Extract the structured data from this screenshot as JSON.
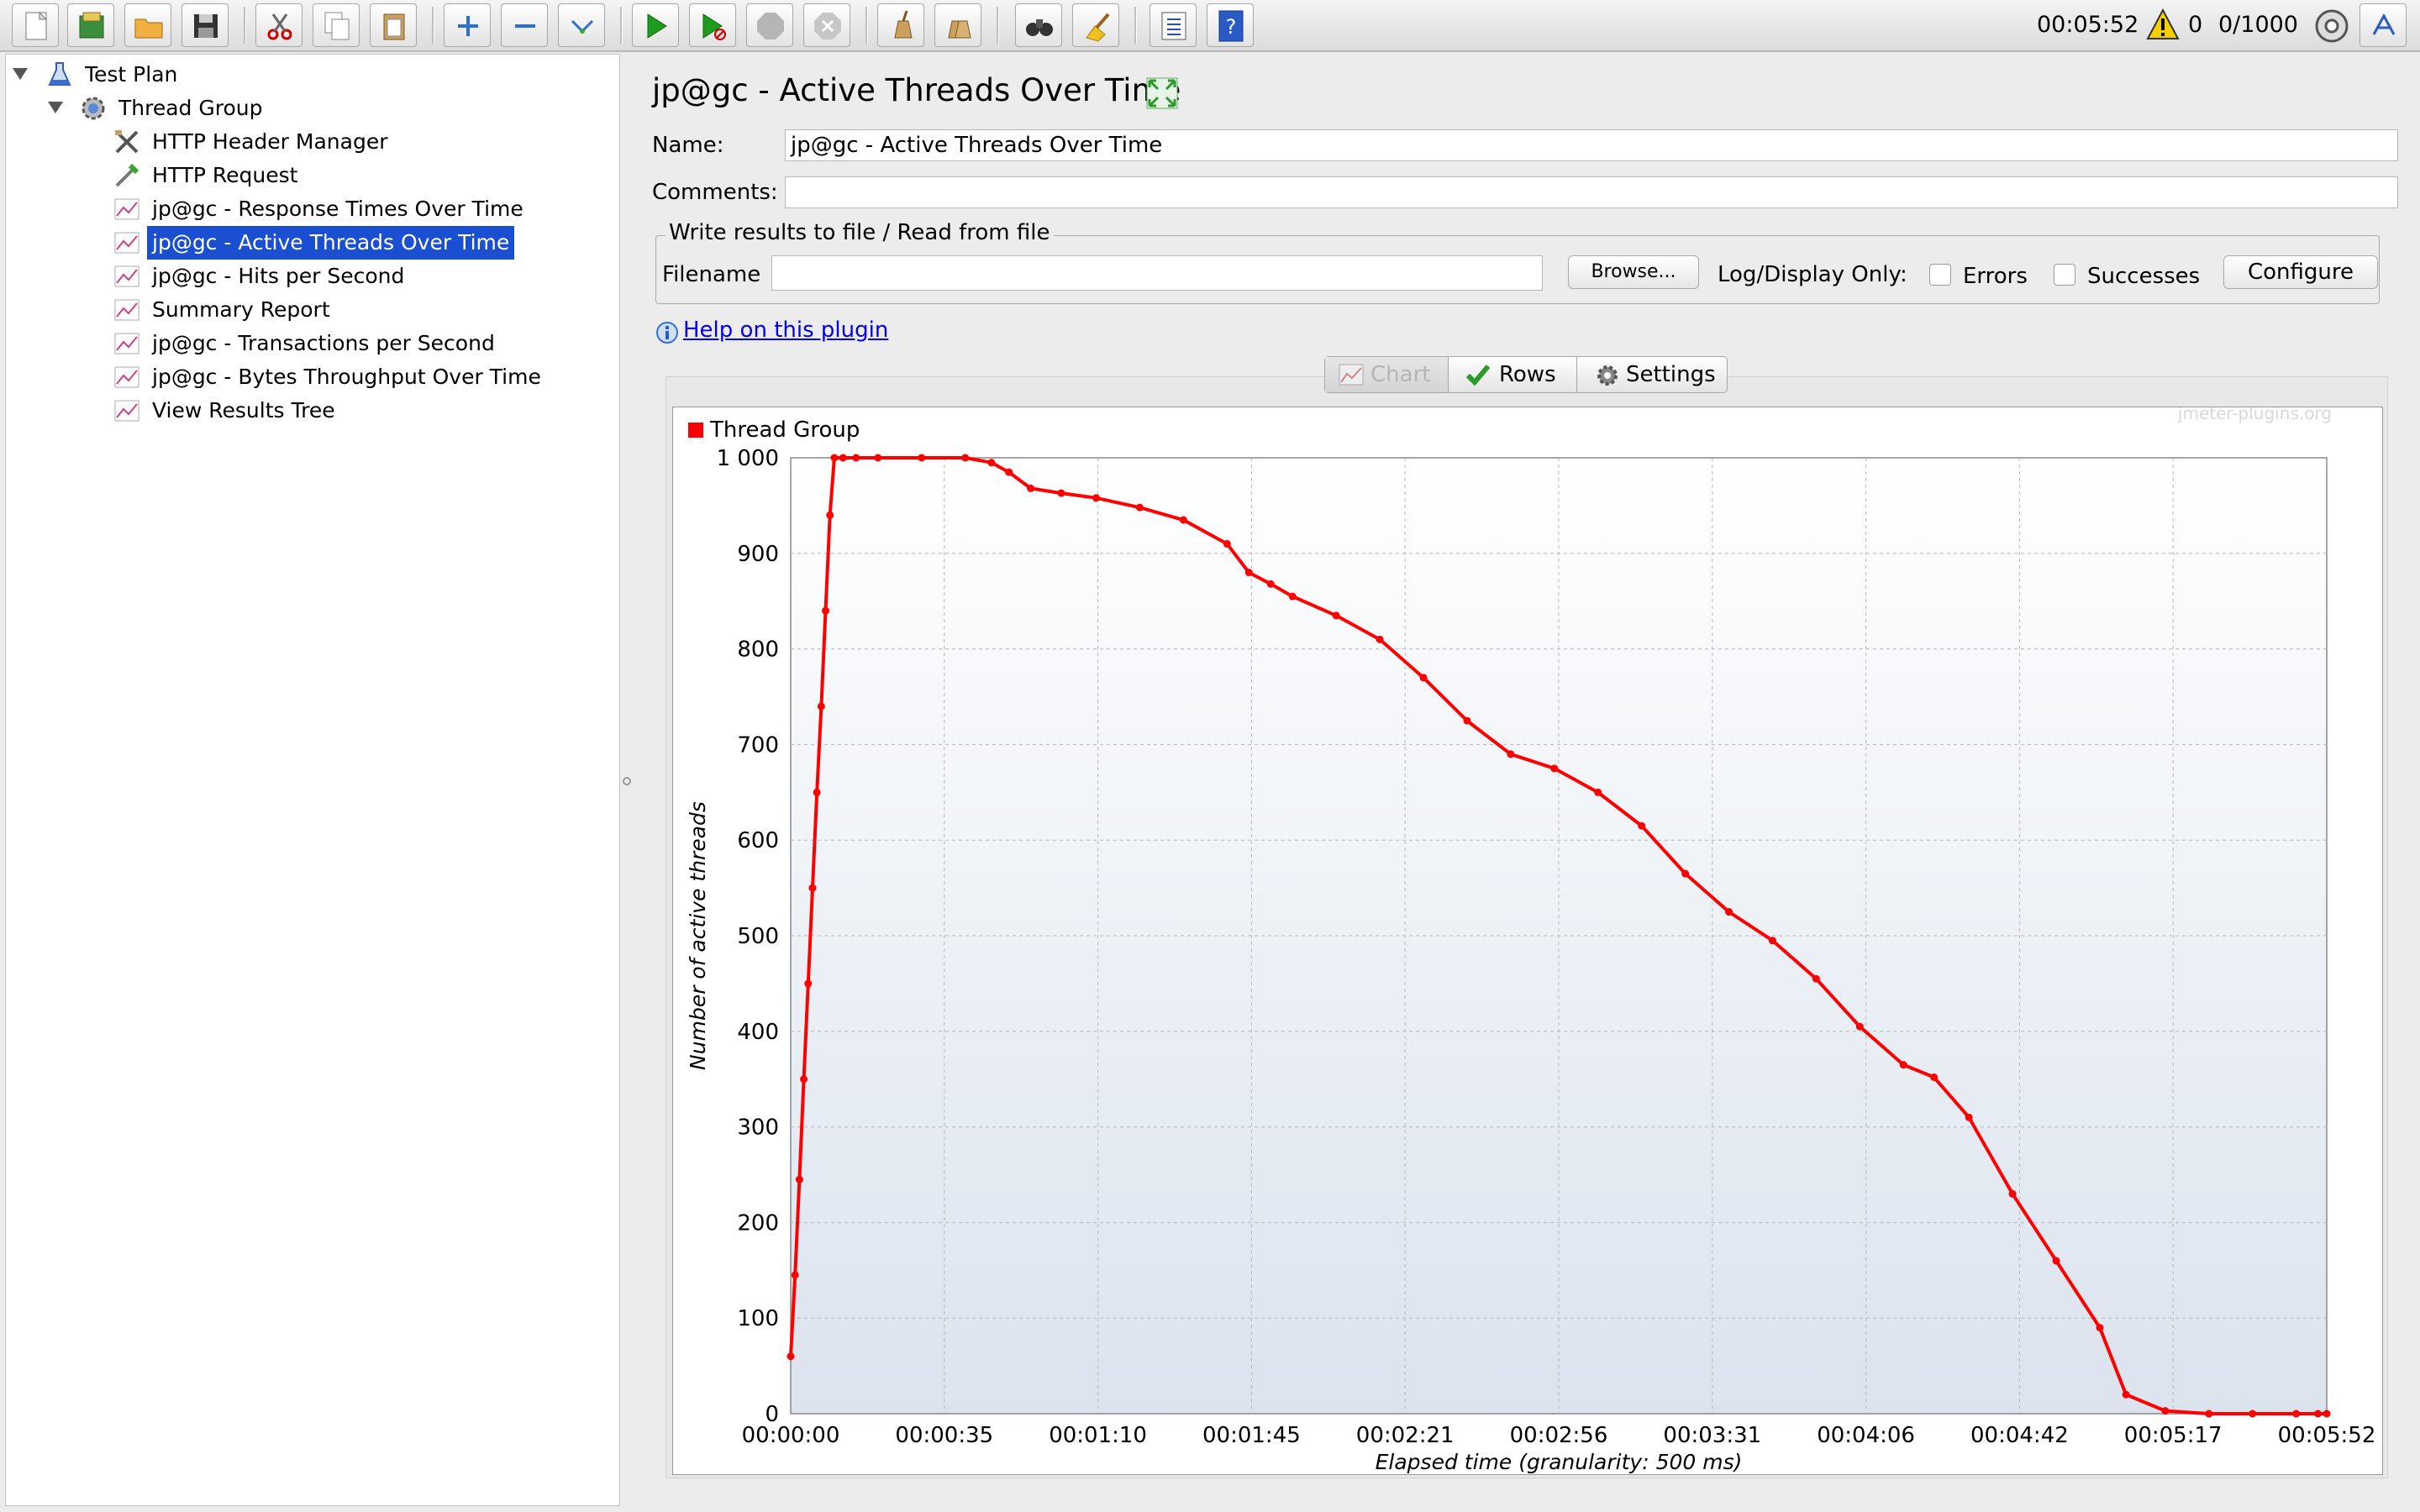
{
  "toolbar": {
    "buttons": [
      "new-icon",
      "templates-icon",
      "open-icon",
      "save-icon",
      "cut-icon",
      "copy-icon",
      "paste-icon",
      "expand-icon",
      "collapse-icon",
      "toggle-icon",
      "start-icon",
      "start-no-pauses-icon",
      "stop-icon",
      "shutdown-icon",
      "clear-icon",
      "clear-all-icon",
      "search-icon",
      "reset-search-icon",
      "function-helper-icon",
      "help-icon"
    ],
    "timer": "00:05:52",
    "warnings": "0",
    "threads": "0/1000"
  },
  "tree": {
    "items": [
      {
        "label": "Test Plan",
        "icon": "test-plan-icon"
      },
      {
        "label": "Thread Group",
        "icon": "thread-group-icon"
      },
      {
        "label": "HTTP Header Manager",
        "icon": "header-manager-icon"
      },
      {
        "label": "HTTP Request",
        "icon": "http-request-icon"
      },
      {
        "label": "jp@gc - Response Times Over Time",
        "icon": "graph-listener-icon"
      },
      {
        "label": "jp@gc - Active Threads Over Time",
        "icon": "graph-listener-icon"
      },
      {
        "label": "jp@gc - Hits per Second",
        "icon": "graph-listener-icon"
      },
      {
        "label": "Summary Report",
        "icon": "graph-listener-icon"
      },
      {
        "label": "jp@gc - Transactions per Second",
        "icon": "graph-listener-icon"
      },
      {
        "label": "jp@gc - Bytes Throughput Over Time",
        "icon": "graph-listener-icon"
      },
      {
        "label": "View Results Tree",
        "icon": "graph-listener-icon"
      }
    ]
  },
  "panel": {
    "title": "jp@gc - Active Threads Over Time",
    "name_label": "Name:",
    "name_value": "jp@gc - Active Threads Over Time",
    "comments_label": "Comments:",
    "comments_value": "",
    "file_group_title": "Write results to file / Read from file",
    "filename_label": "Filename",
    "filename_value": "",
    "browse_label": "Browse...",
    "log_display_label": "Log/Display Only:",
    "errors_label": "Errors",
    "successes_label": "Successes",
    "configure_label": "Configure",
    "help_link": "Help on this plugin",
    "tabs": [
      "Chart",
      "Rows",
      "Settings"
    ],
    "active_tab": "Chart"
  },
  "chart_data": {
    "type": "line",
    "watermark": "jmeter-plugins.org",
    "xlabel": "Elapsed time (granularity: 500 ms)",
    "ylabel": "Number of active threads",
    "ylim": [
      0,
      1000
    ],
    "xlim_seconds": [
      0,
      352
    ],
    "y_ticks": [
      "0",
      "100",
      "200",
      "300",
      "400",
      "500",
      "600",
      "700",
      "800",
      "900",
      "1 000"
    ],
    "x_ticks": [
      "00:00:00",
      "00:00:35",
      "00:01:10",
      "00:01:45",
      "00:02:21",
      "00:02:56",
      "00:03:31",
      "00:04:06",
      "00:04:42",
      "00:05:17",
      "00:05:52"
    ],
    "grid": true,
    "legend": "top-left",
    "series": [
      {
        "name": "Thread Group",
        "color": "#ff0000",
        "x_seconds": [
          0,
          1,
          2,
          3,
          4,
          5,
          6,
          7,
          8,
          9,
          10,
          12,
          15,
          20,
          30,
          40,
          46,
          50,
          55,
          62,
          70,
          80,
          90,
          100,
          105,
          110,
          115,
          125,
          135,
          145,
          155,
          165,
          175,
          185,
          195,
          205,
          215,
          225,
          235,
          245,
          255,
          262,
          270,
          280,
          290,
          300,
          306,
          315,
          325,
          335,
          345,
          350,
          352
        ],
        "values": [
          60,
          145,
          245,
          350,
          450,
          550,
          650,
          740,
          840,
          940,
          1000,
          1000,
          1000,
          1000,
          1000,
          1000,
          995,
          985,
          968,
          963,
          958,
          948,
          935,
          910,
          880,
          868,
          855,
          835,
          810,
          770,
          725,
          690,
          675,
          650,
          615,
          565,
          525,
          495,
          455,
          405,
          365,
          352,
          310,
          230,
          160,
          90,
          20,
          3,
          0,
          0,
          0,
          0,
          0
        ]
      }
    ]
  }
}
